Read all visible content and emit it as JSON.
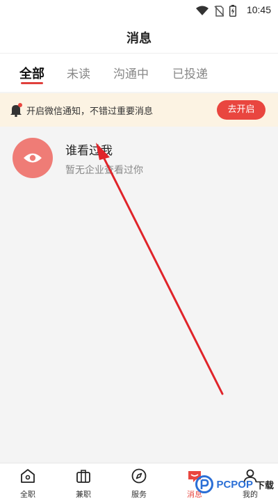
{
  "status_bar": {
    "time": "10:45",
    "icons": [
      "wifi-icon",
      "no-sim-icon",
      "battery-icon"
    ]
  },
  "header": {
    "title": "消息"
  },
  "tabs": [
    {
      "label": "全部",
      "active": true
    },
    {
      "label": "未读",
      "active": false
    },
    {
      "label": "沟通中",
      "active": false
    },
    {
      "label": "已投递",
      "active": false
    }
  ],
  "notice": {
    "text": "开启微信通知，不错过重要消息",
    "button_label": "去开启"
  },
  "messages": [
    {
      "title": "谁看过我",
      "subtitle": "暂无企业查看过你",
      "icon": "eye-icon"
    }
  ],
  "bottom_nav": [
    {
      "label": "全职",
      "icon": "home-icon",
      "active": false
    },
    {
      "label": "兼职",
      "icon": "briefcase-icon",
      "active": false
    },
    {
      "label": "服务",
      "icon": "compass-icon",
      "active": false
    },
    {
      "label": "消息",
      "icon": "message-icon",
      "active": true
    },
    {
      "label": "我的",
      "icon": "user-icon",
      "active": false
    }
  ],
  "watermark": {
    "text": "PCPOP",
    "suffix": "下载"
  },
  "colors": {
    "accent": "#e9463f",
    "notice_bg": "#fcf3e3",
    "avatar": "#ef7c76",
    "arrow": "#e0242a"
  }
}
